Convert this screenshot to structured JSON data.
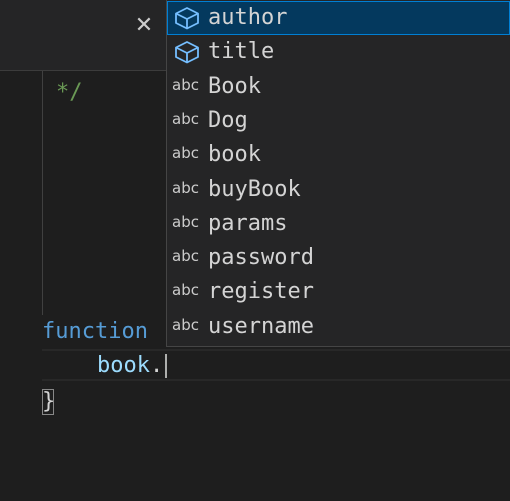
{
  "tab": {
    "close_glyph": "✕"
  },
  "editor": {
    "lines": {
      "comment": "*/",
      "function_keyword": "function",
      "object_name": "book",
      "dot": ".",
      "closing_brace": "}"
    },
    "colors": {
      "comment": "#6a9955",
      "keyword": "#569cd6",
      "identifier": "#9cdcfe"
    }
  },
  "suggest": {
    "items": [
      {
        "label": "author",
        "kind": "property",
        "icon": "cube-icon",
        "selected": true
      },
      {
        "label": "title",
        "kind": "property",
        "icon": "cube-icon",
        "selected": false
      },
      {
        "label": "Book",
        "kind": "text",
        "icon": "abc",
        "selected": false
      },
      {
        "label": "Dog",
        "kind": "text",
        "icon": "abc",
        "selected": false
      },
      {
        "label": "book",
        "kind": "text",
        "icon": "abc",
        "selected": false
      },
      {
        "label": "buyBook",
        "kind": "text",
        "icon": "abc",
        "selected": false
      },
      {
        "label": "params",
        "kind": "text",
        "icon": "abc",
        "selected": false
      },
      {
        "label": "password",
        "kind": "text",
        "icon": "abc",
        "selected": false
      },
      {
        "label": "register",
        "kind": "text",
        "icon": "abc",
        "selected": false
      },
      {
        "label": "username",
        "kind": "text",
        "icon": "abc",
        "selected": false
      }
    ],
    "selected_bg": "#04395e",
    "selected_border": "#007fd4",
    "property_icon_color": "#75beff"
  }
}
